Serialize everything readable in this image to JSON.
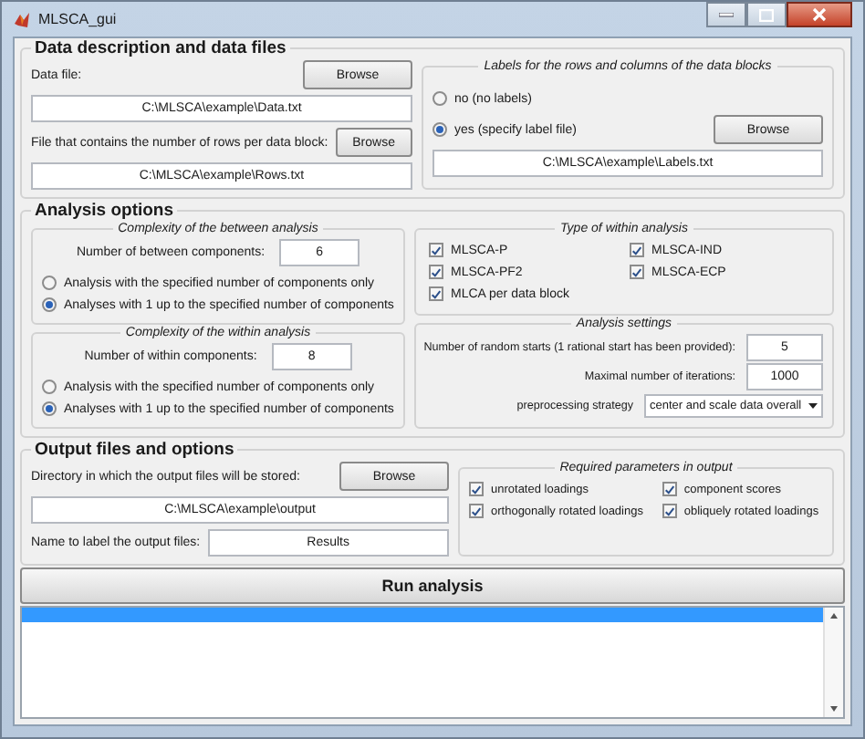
{
  "window": {
    "title": "MLSCA_gui"
  },
  "data_files": {
    "title": "Data description and data files",
    "data_file": {
      "label": "Data file:",
      "button": "Browse",
      "value": "C:\\MLSCA\\example\\Data.txt"
    },
    "rows_file": {
      "label": "File that contains the number of rows per data block:",
      "button": "Browse",
      "value": "C:\\MLSCA\\example\\Rows.txt"
    },
    "labels": {
      "title": "Labels for the rows and columns of the data blocks",
      "options": [
        {
          "label": "no (no labels)",
          "selected": false
        },
        {
          "label": "yes (specify label file)",
          "selected": true
        }
      ],
      "button": "Browse",
      "value": "C:\\MLSCA\\example\\Labels.txt"
    }
  },
  "analysis_options": {
    "title": "Analysis options",
    "between": {
      "title": "Complexity of the between analysis",
      "components_label": "Number of between components:",
      "components_value": "6",
      "options": [
        {
          "label": "Analysis with the specified number of components only",
          "selected": false
        },
        {
          "label": "Analyses with 1 up to the specified number of components",
          "selected": true
        }
      ]
    },
    "within": {
      "title": "Complexity of the within analysis",
      "components_label": "Number of within components:",
      "components_value": "8",
      "options": [
        {
          "label": "Analysis with the specified number of components only",
          "selected": false
        },
        {
          "label": "Analyses with 1 up to the specified number of components",
          "selected": true
        }
      ]
    },
    "within_type": {
      "title": "Type of within analysis",
      "options": [
        {
          "label": "MLSCA-P",
          "checked": true
        },
        {
          "label": "MLSCA-IND",
          "checked": true
        },
        {
          "label": "MLSCA-PF2",
          "checked": true
        },
        {
          "label": "MLSCA-ECP",
          "checked": true
        },
        {
          "label": "MLCA per data block",
          "checked": true
        }
      ]
    },
    "settings": {
      "title": "Analysis settings",
      "fields": [
        {
          "kind": "input",
          "label": "Number of random starts (1 rational start has been provided):",
          "value": "5"
        },
        {
          "kind": "input",
          "label": "Maximal number of iterations:",
          "value": "1000"
        },
        {
          "kind": "dropdown",
          "label": "preprocessing strategy",
          "value": "center and scale data overall"
        }
      ]
    }
  },
  "output": {
    "title": "Output files and options",
    "directory": {
      "label": "Directory in which the output files will be stored:",
      "button": "Browse",
      "value": "C:\\MLSCA\\example\\output"
    },
    "name": {
      "label": "Name to label the output files:",
      "value": "Results"
    },
    "parameters": {
      "title": "Required parameters in output",
      "options": [
        {
          "label": "unrotated loadings",
          "checked": true
        },
        {
          "label": "component scores",
          "checked": true
        },
        {
          "label": "orthogonally rotated loadings",
          "checked": true
        },
        {
          "label": "obliquely rotated loadings",
          "checked": true
        }
      ]
    }
  },
  "run_button": "Run analysis",
  "log": {
    "rows": [
      {
        "selected": true
      }
    ]
  }
}
